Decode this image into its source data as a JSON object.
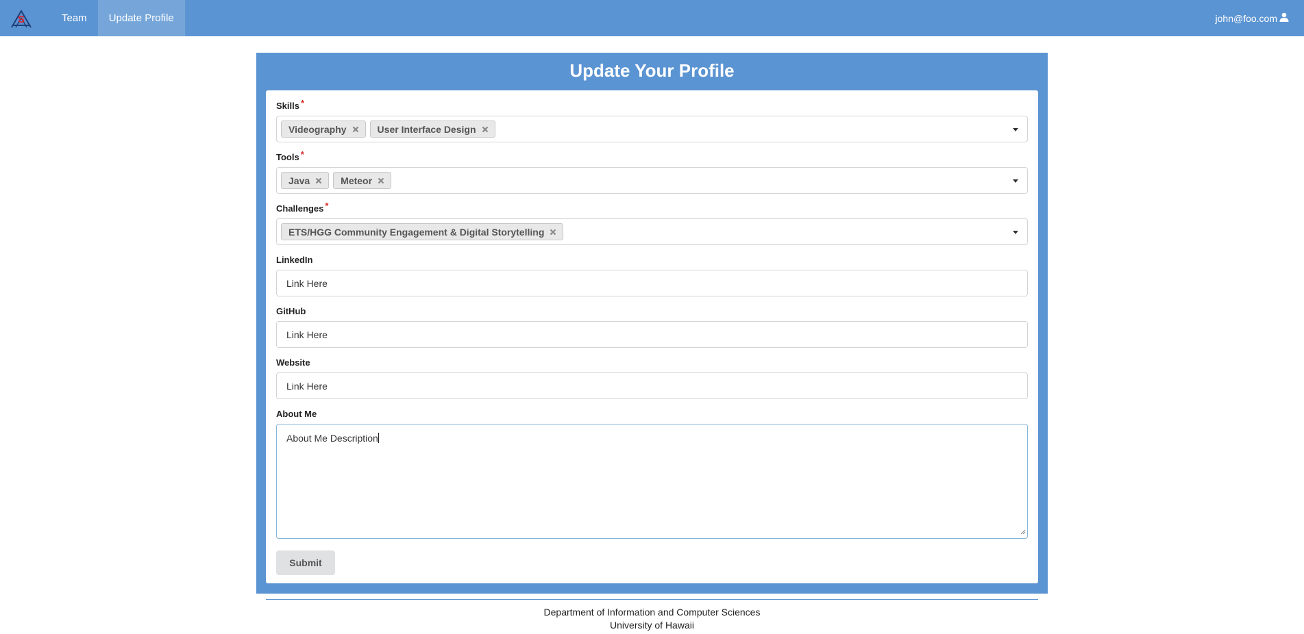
{
  "nav": {
    "logo_icon": "hackathon-logo-icon",
    "items": [
      {
        "label": "Team",
        "active": false
      },
      {
        "label": "Update Profile",
        "active": true
      }
    ],
    "user_email": "john@foo.com",
    "user_icon": "user-icon"
  },
  "card": {
    "title": "Update Your Profile"
  },
  "form": {
    "skills": {
      "label": "Skills",
      "required": "*",
      "selected": [
        "Videography",
        "User Interface Design"
      ]
    },
    "tools": {
      "label": "Tools",
      "required": "*",
      "selected": [
        "Java",
        "Meteor"
      ]
    },
    "challenges": {
      "label": "Challenges",
      "required": "*",
      "selected": [
        "ETS/HGG Community Engagement & Digital Storytelling"
      ]
    },
    "linkedin": {
      "label": "LinkedIn",
      "value": "Link Here"
    },
    "github": {
      "label": "GitHub",
      "value": "Link Here"
    },
    "website": {
      "label": "Website",
      "value": "Link Here"
    },
    "about": {
      "label": "About Me",
      "value": "About Me Description"
    },
    "submit_label": "Submit"
  },
  "footer": {
    "line1": "Department of Information and Computer Sciences",
    "line2": "University of Hawaii"
  },
  "colors": {
    "primary": "#5b94d2",
    "required": "#db2828",
    "chip_bg": "#e8e8e8",
    "button_bg": "#e0e1e2"
  }
}
